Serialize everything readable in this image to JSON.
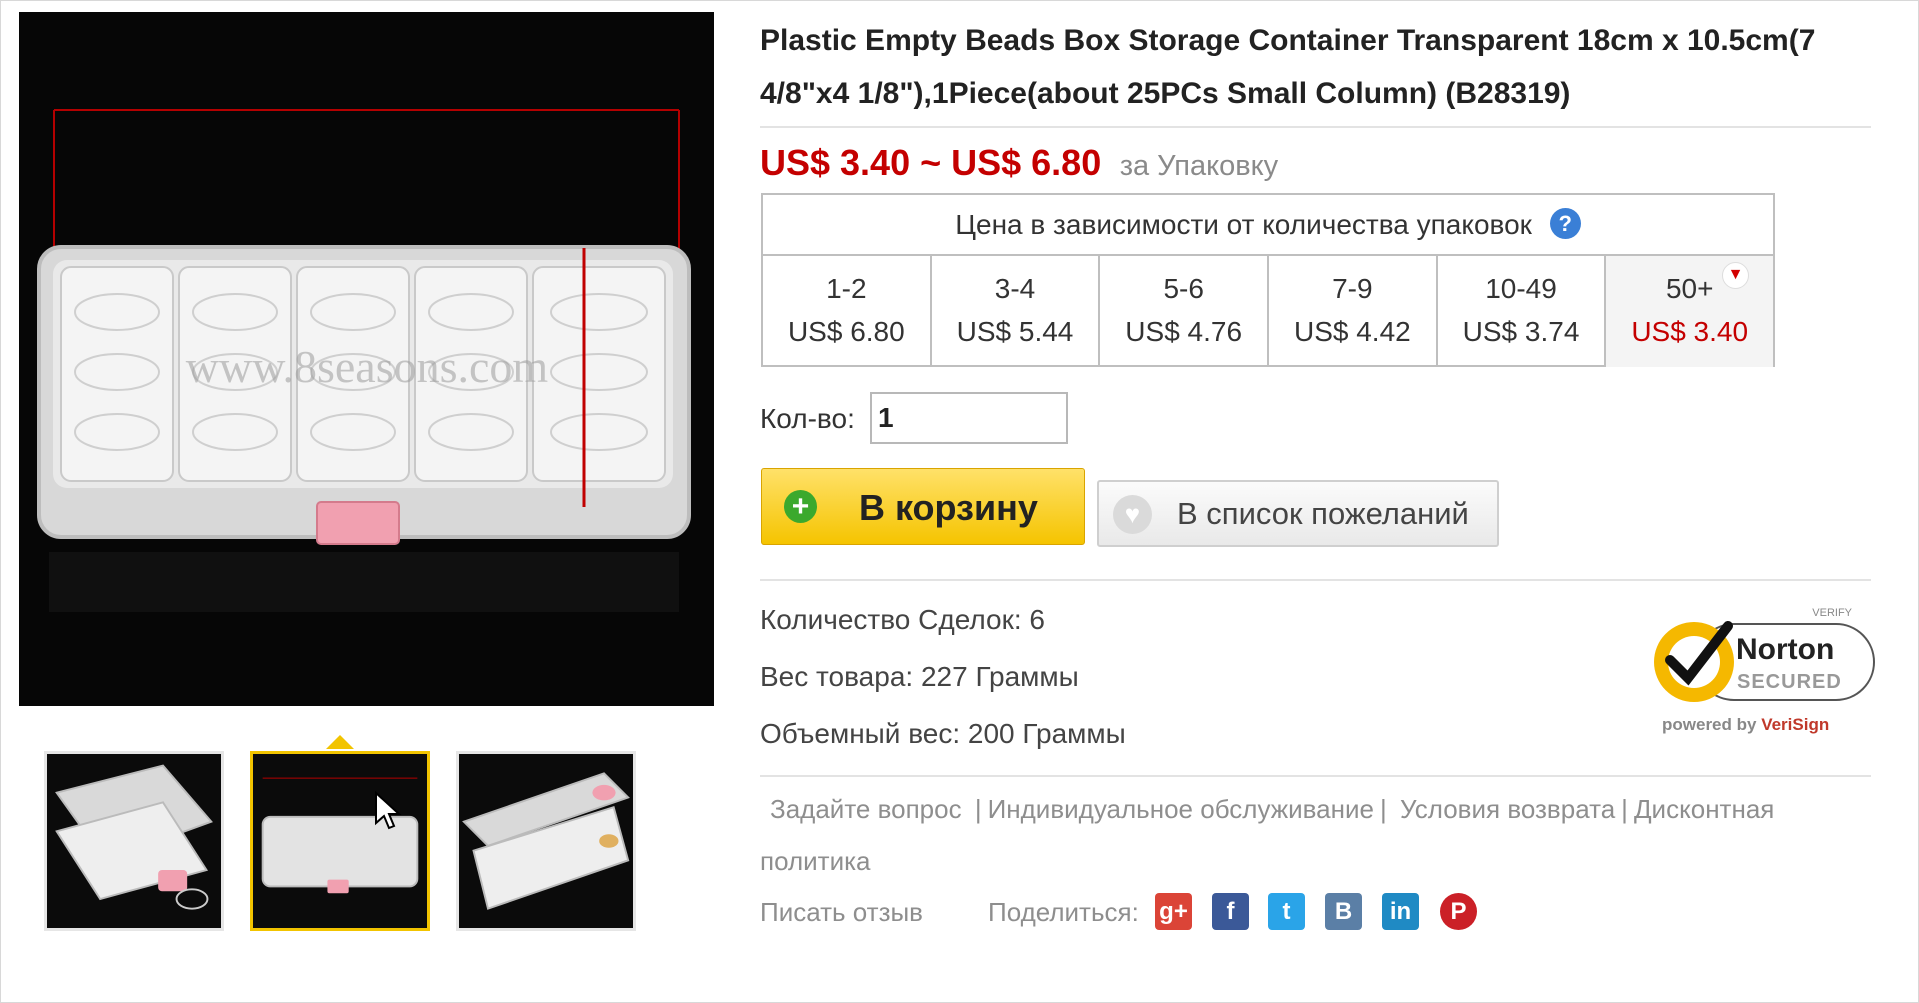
{
  "product": {
    "title": "Plastic Empty Beads Box Storage Container Transparent 18cm x 10.5cm(7 4/8\"x4 1/8\"),1Piece(about 25PCs Small Column)  (B28319)",
    "price_range": "US$ 3.40 ~ US$ 6.80",
    "price_unit": "за Упаковку",
    "watermark": "www.8seasons.com"
  },
  "tiers": {
    "header": "Цена в зависимости от количества упаковок",
    "help_icon": "?",
    "items": [
      {
        "qty": "1-2",
        "price": "US$ 6.80"
      },
      {
        "qty": "3-4",
        "price": "US$ 5.44"
      },
      {
        "qty": "5-6",
        "price": "US$ 4.76"
      },
      {
        "qty": "7-9",
        "price": "US$ 4.42"
      },
      {
        "qty": "10-49",
        "price": "US$ 3.74"
      },
      {
        "qty": "50+",
        "price": "US$ 3.40"
      }
    ]
  },
  "quantity": {
    "label": "Кол-во:",
    "value": "1"
  },
  "buttons": {
    "cart": "В корзину",
    "cart_icon": "+",
    "wishlist": "В список пожеланий",
    "wishlist_icon": "♥"
  },
  "details": {
    "deals": "Количество Сделок: 6",
    "weight": "Вес товара: 227 Граммы",
    "volume_weight": "Объемный вес: 200 Граммы"
  },
  "norton": {
    "verify": "VERIFY",
    "brand": "Norton",
    "secured": "SECURED",
    "powered_prefix": "powered by ",
    "powered_brand": "VeriSign"
  },
  "links": {
    "ask": "Задайте вопрос",
    "service": "Индивидуальное обслуживание",
    "returns": "Условия возврата",
    "discount": "Дисконтная политика",
    "review": "Писать отзыв",
    "share": "Поделиться:"
  },
  "social": {
    "gplus": "g+",
    "facebook": "f",
    "twitter": "t",
    "vk": "B",
    "linkedin": "in",
    "pinterest": "P"
  },
  "colors": {
    "price_red": "#c40000",
    "accent_yellow": "#f5c400",
    "help_blue": "#3a7fd6"
  }
}
